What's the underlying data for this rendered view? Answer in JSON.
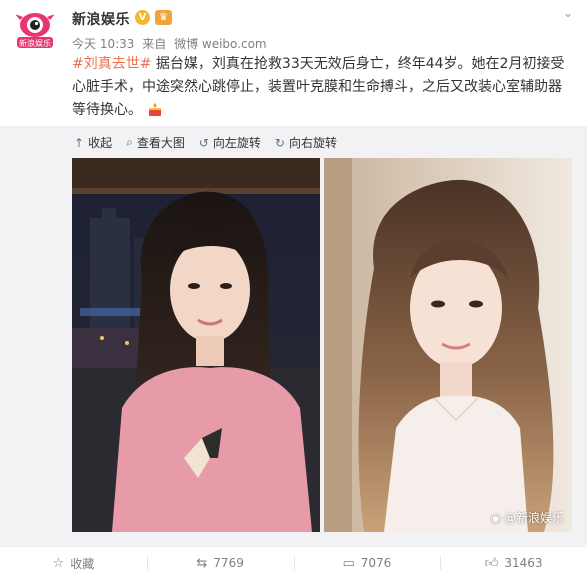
{
  "header": {
    "account_name": "新浪娱乐",
    "verified_badge": "V",
    "member_badge": "♛",
    "dropdown_glyph": "⌄",
    "timestamp": "今天 10:33",
    "source_prefix": "来自",
    "source": "微博 weibo.com",
    "avatar_text": "新浪娱乐"
  },
  "post": {
    "hashtag": "#刘真去世#",
    "body": " 据台媒，刘真在抢救33天无效后身亡，终年44岁。她在2月初接受心脏手术，中途突然心跳停止，装置叶克膜和生命搏斗，之后又改装心室辅助器等待换心。"
  },
  "media": {
    "tools": [
      {
        "icon": "collapse-icon",
        "glyph": "↑",
        "label": "收起"
      },
      {
        "icon": "magnify-icon",
        "glyph": "⌕",
        "label": "查看大图"
      },
      {
        "icon": "rotate-left-icon",
        "glyph": "↺",
        "label": "向左旋转"
      },
      {
        "icon": "rotate-right-icon",
        "glyph": "↻",
        "label": "向右旋转"
      }
    ],
    "watermark": "@新浪娱乐"
  },
  "footer": {
    "favorite_label": "收藏",
    "repost_count": "7769",
    "comment_count": "7076",
    "like_count": "31463"
  },
  "colors": {
    "accent": "#eb7350",
    "meta_gray": "#808080",
    "media_bg": "#f2f2f5",
    "badge_orange": "#f7b52c"
  }
}
